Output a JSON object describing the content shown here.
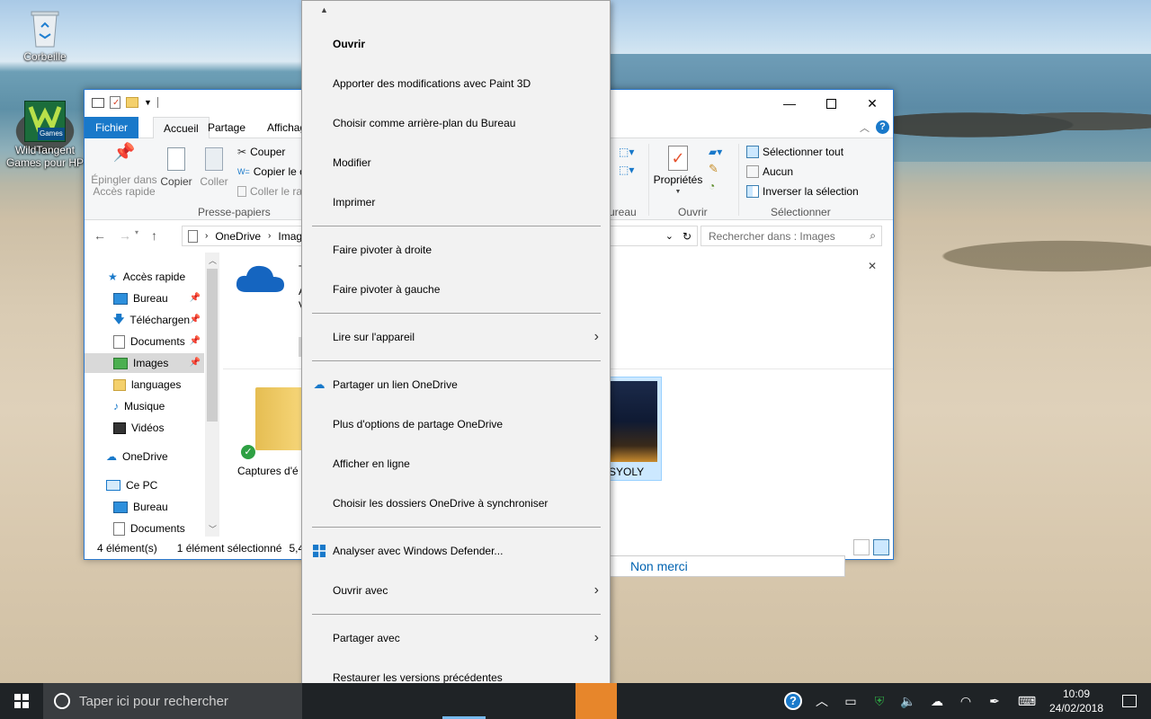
{
  "desktop": {
    "icons": [
      {
        "label": "Corbeille"
      },
      {
        "label": "WildTangent Games pour HP",
        "badge": "Games"
      }
    ]
  },
  "explorer": {
    "tabs": [
      "Fichier",
      "Accueil",
      "Partage",
      "Affichage"
    ],
    "ribbon": {
      "pin_label": "Épingler dans Accès rapide",
      "copy": "Copier",
      "paste": "Coller",
      "cut": "Couper",
      "copy_path": "Copier le c",
      "paste_shortcut": "Coller le ra",
      "group_clipboard": "Presse-papiers",
      "group_organize_partial": "ureau",
      "properties": "Propriétés",
      "group_open": "Ouvrir",
      "select_all": "Sélectionner tout",
      "select_none": "Aucun",
      "invert_selection": "Inverser la sélection",
      "group_select": "Sélectionner"
    },
    "address": {
      "crumbs": [
        "OneDrive",
        "Imag"
      ],
      "search_placeholder": "Rechercher dans : Images"
    },
    "nav": [
      {
        "label": "Accès rapide"
      },
      {
        "label": "Bureau"
      },
      {
        "label": "Téléchargen"
      },
      {
        "label": "Documents"
      },
      {
        "label": "Images"
      },
      {
        "label": "languages"
      },
      {
        "label": "Musique"
      },
      {
        "label": "Vidéos"
      },
      {
        "label": "OneDrive"
      },
      {
        "label": "Ce PC"
      },
      {
        "label": "Bureau"
      },
      {
        "label": "Documents"
      }
    ],
    "banner": {
      "line1": "T",
      "line2": "A",
      "line3": "V"
    },
    "tiles": {
      "folder_label": "Captures d'é",
      "selected_label": "SYOLY"
    },
    "status": {
      "count": "4 élément(s)",
      "selected": "1 élément sélectionné",
      "size": "5,42"
    },
    "nomerci": "Non merci"
  },
  "context_menu": {
    "items": [
      {
        "label": "Ouvrir",
        "bold": true
      },
      {
        "label": "Apporter des modifications avec Paint 3D"
      },
      {
        "label": "Choisir comme arrière-plan du Bureau"
      },
      {
        "label": "Modifier"
      },
      {
        "label": "Imprimer"
      },
      {
        "label": "Faire pivoter à droite"
      },
      {
        "label": "Faire pivoter à gauche"
      },
      {
        "label": "Lire sur l'appareil",
        "submenu": true
      },
      {
        "label": "Partager un lien OneDrive",
        "icon": "onedrive-icon"
      },
      {
        "label": "Plus d'options de partage OneDrive"
      },
      {
        "label": "Afficher en ligne"
      },
      {
        "label": "Choisir les dossiers OneDrive à synchroniser"
      },
      {
        "label": "Analyser avec Windows Defender...",
        "icon": "defender-icon"
      },
      {
        "label": "Ouvrir avec",
        "submenu": true
      },
      {
        "label": "Partager avec",
        "submenu": true
      },
      {
        "label": "Restaurer les versions précédentes"
      }
    ]
  },
  "taskbar": {
    "search_placeholder": "Taper ici pour rechercher",
    "time": "10:09",
    "date": "24/02/2018"
  },
  "colors": {
    "accent": "#1979ca",
    "taskbar": "#1f2326",
    "menu_bg": "#f2f2f2"
  }
}
